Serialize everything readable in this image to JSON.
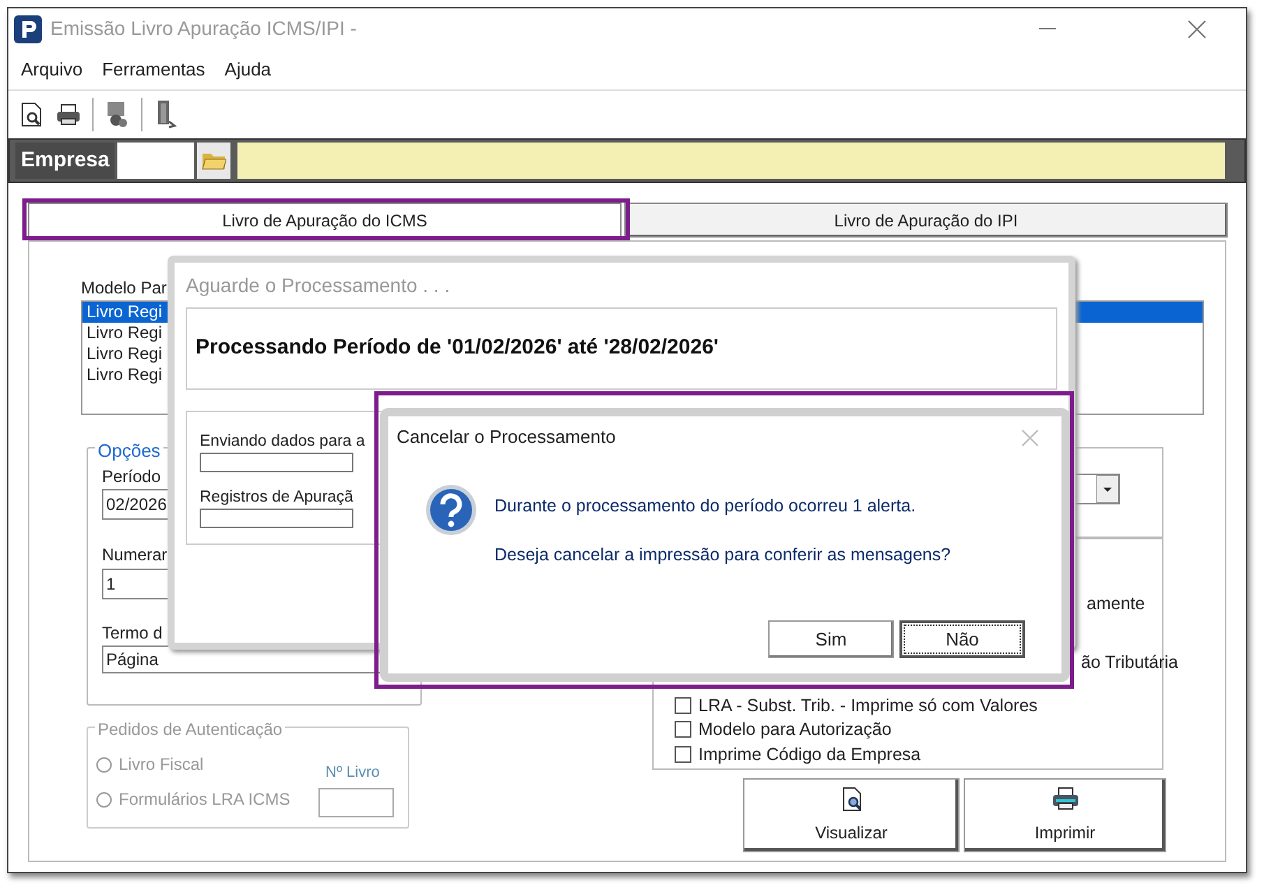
{
  "window": {
    "title": "Emissão Livro Apuração ICMS/IPI -"
  },
  "menu": [
    "Arquivo",
    "Ferramentas",
    "Ajuda"
  ],
  "empresa": {
    "label": "Empresa"
  },
  "tabs": [
    {
      "label": "Livro de Apuração do ICMS",
      "selected": true
    },
    {
      "label": "Livro de Apuração do IPI",
      "selected": false
    }
  ],
  "modelo": {
    "label": "Modelo Par",
    "items": [
      {
        "label": "Livro Regi",
        "selected": true
      },
      {
        "label": "Livro Regi",
        "selected": false
      },
      {
        "label": "Livro Regi",
        "selected": false
      },
      {
        "label": "Livro Regi",
        "selected": false
      }
    ]
  },
  "opcoes": {
    "title": "Opções",
    "periodo_label": "Período",
    "periodo_value": "02/2026",
    "numerar_label": "Numerar",
    "numerar_value": "1",
    "termo_label": "Termo d",
    "termo_value": "Página"
  },
  "checkboxes": [
    {
      "kind": "partial",
      "label": "amente"
    },
    {
      "kind": "partial",
      "label": "ão Tributária"
    },
    {
      "kind": "checkbox",
      "label": "LRA - Subst. Trib. - Imprime só com Valores",
      "checked": false
    },
    {
      "kind": "checkbox",
      "label": "Modelo para Autorização",
      "checked": false
    },
    {
      "kind": "checkbox",
      "label": "Imprime Código da Empresa",
      "checked": false
    }
  ],
  "autenticacao": {
    "title": "Pedidos de Autenticação",
    "disabled": true,
    "options": [
      {
        "label": "Livro Fiscal",
        "selected": false
      },
      {
        "label": "Formulários LRA ICMS",
        "selected": false
      }
    ],
    "livro_label": "Nº Livro"
  },
  "buttons": [
    {
      "kind": "preview",
      "label": "Visualizar"
    },
    {
      "kind": "print",
      "label": "Imprimir"
    }
  ],
  "progress_dialog": {
    "title": "Aguarde o Processamento . . .",
    "heading": "Processando Período de '01/02/2026' até '28/02/2026'",
    "steps": [
      {
        "label": "Enviando dados para a",
        "level": 0
      },
      {
        "label": "Registros de Apuraçã",
        "level": 0
      }
    ]
  },
  "confirm_dialog": {
    "title": "Cancelar o Processamento",
    "lines": [
      "Durante o processamento do período ocorreu 1 alerta.",
      "Deseja cancelar a impressão para conferir as mensagens?"
    ],
    "buttons": [
      {
        "label": "Sim",
        "default": false
      },
      {
        "label": "Não",
        "default": true
      }
    ]
  }
}
